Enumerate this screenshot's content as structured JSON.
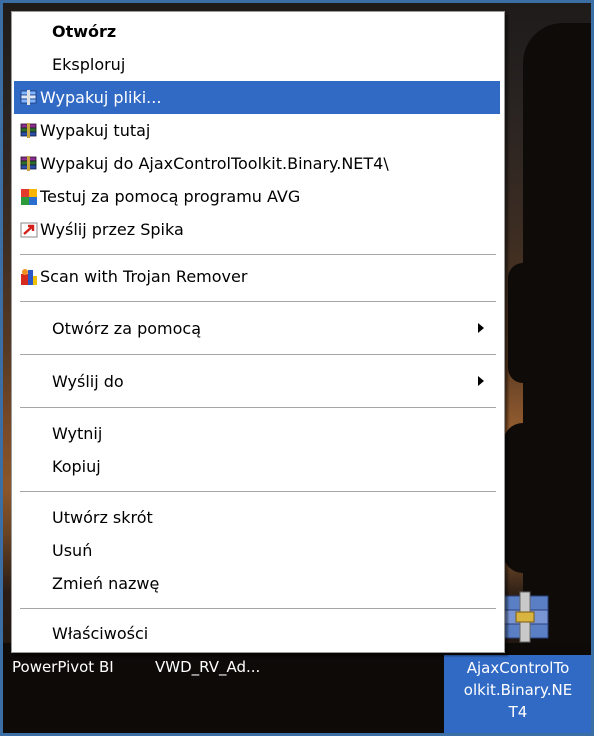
{
  "menu": {
    "items": [
      {
        "label": "Otwórz",
        "icon": "none",
        "bold": true
      },
      {
        "label": "Eksploruj",
        "icon": "none"
      },
      {
        "label": "Wypakuj pliki...",
        "icon": "winrar-extract-icon",
        "highlighted": true
      },
      {
        "label": "Wypakuj tutaj",
        "icon": "winrar-icon"
      },
      {
        "label": "Wypakuj do AjaxControlToolkit.Binary.NET4\\",
        "icon": "winrar-icon"
      },
      {
        "label": "Testuj za pomocą programu AVG",
        "icon": "avg-icon"
      },
      {
        "label": "Wyślij przez Spika",
        "icon": "spik-icon"
      },
      {
        "label": "Scan with Trojan Remover",
        "icon": "trojan-remover-icon"
      },
      {
        "label": "Otwórz za pomocą",
        "icon": "none",
        "submenu": true
      },
      {
        "label": "Wyślij do",
        "icon": "none",
        "submenu": true
      },
      {
        "label": "Wytnij",
        "icon": "none"
      },
      {
        "label": "Kopiuj",
        "icon": "none"
      },
      {
        "label": "Utwórz skrót",
        "icon": "none"
      },
      {
        "label": "Usuń",
        "icon": "none"
      },
      {
        "label": "Zmień nazwę",
        "icon": "none"
      },
      {
        "label": "Właściwości",
        "icon": "none"
      }
    ]
  },
  "desktop": {
    "icons": [
      {
        "label": "PowerPivot BI"
      },
      {
        "label": "VWD_RV_Ad..."
      },
      {
        "label_lines": [
          "AjaxControlTo",
          "olkit.Binary.NE",
          "T4"
        ],
        "selected": true,
        "icon": "winrar-archive-icon"
      }
    ]
  },
  "colors": {
    "highlight": "#316ac5",
    "frame_border": "#3b6ea5",
    "menu_bg": "#ffffff"
  }
}
